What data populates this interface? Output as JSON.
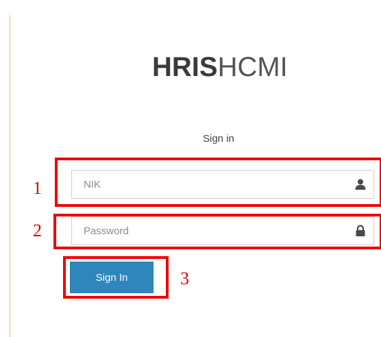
{
  "brand": {
    "bold": "HRIS",
    "light": "HCMI"
  },
  "signin": {
    "heading": "Sign in",
    "nik_placeholder": "NIK",
    "nik_value": "",
    "password_placeholder": "Password",
    "password_value": "",
    "button_label": "Sign In"
  },
  "annotations": {
    "one": "1",
    "two": "2",
    "three": "3"
  },
  "icons": {
    "nik": "user-icon",
    "password": "lock-icon"
  },
  "colors": {
    "button": "#2f86bd",
    "annotation": "#ee0000",
    "rule": "#e8c06a"
  }
}
